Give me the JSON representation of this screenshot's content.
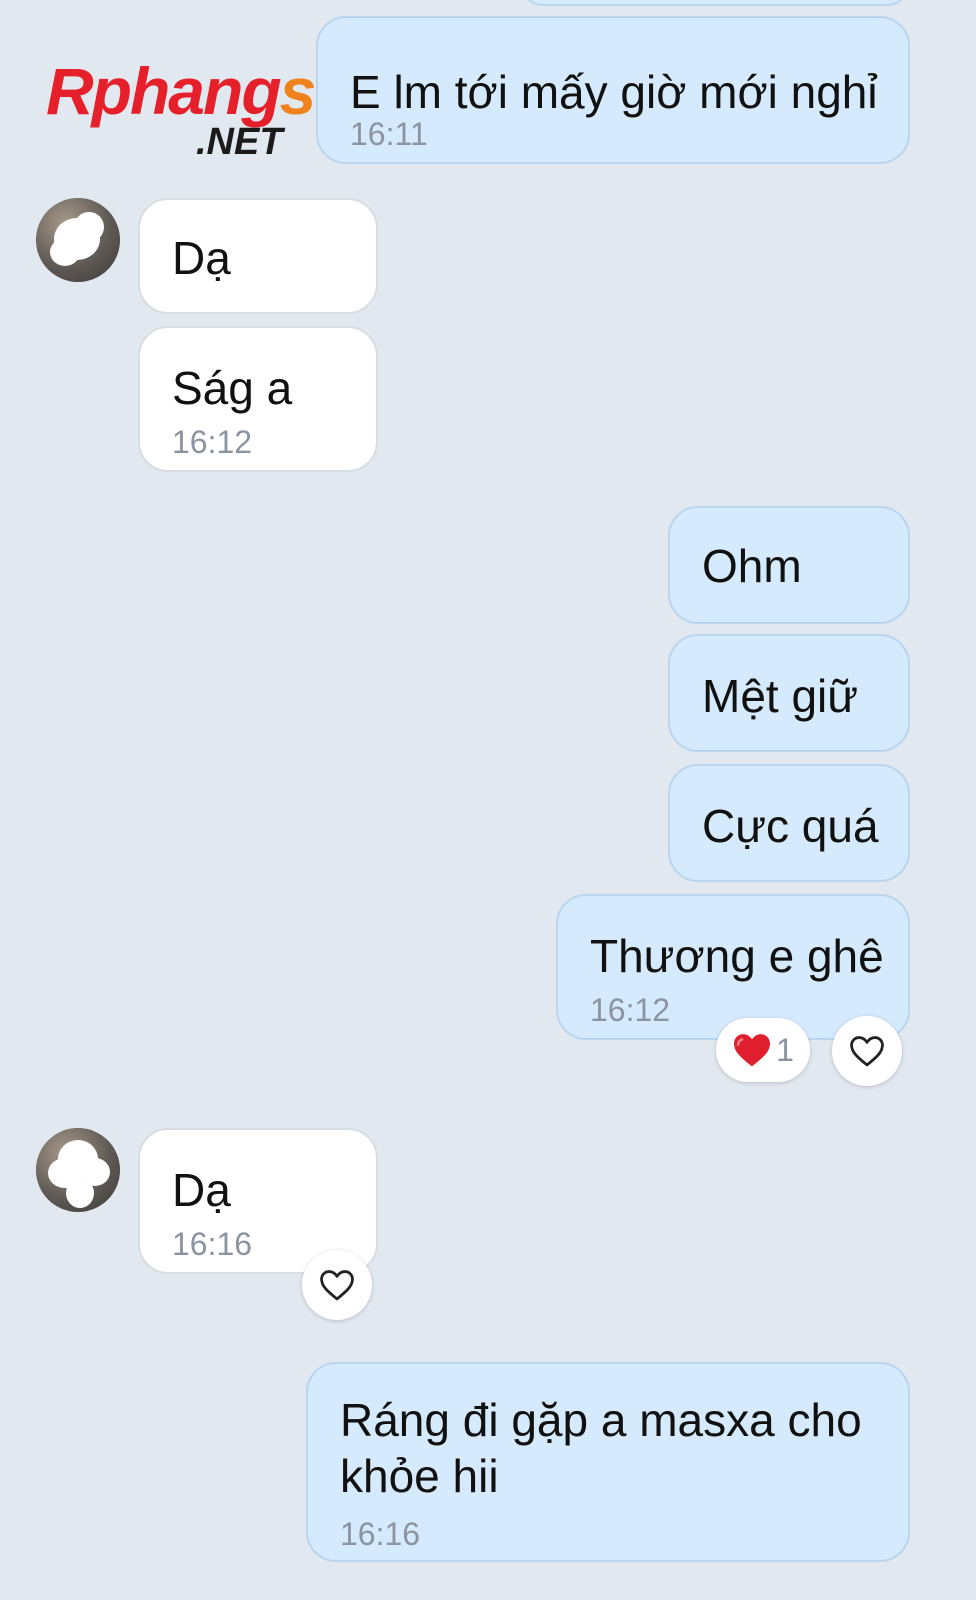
{
  "watermark": {
    "text_rphang": "Rphang",
    "text_s": "s",
    "text_net": ".NET"
  },
  "messages": [
    {
      "text": "E lm tới mấy giờ mới nghỉ",
      "time": "16:11"
    },
    {
      "text": "Dạ"
    },
    {
      "text": "Ság a",
      "time": "16:12"
    },
    {
      "text": "Ohm"
    },
    {
      "text": "Mệt giữ"
    },
    {
      "text": "Cực quá"
    },
    {
      "text": "Thương e ghê",
      "time": "16:12",
      "reaction_count": "1"
    },
    {
      "text": "Dạ",
      "time": "16:16"
    },
    {
      "text": "Ráng đi gặp a masxa cho khỏe hii",
      "time": "16:16"
    }
  ],
  "colors": {
    "outgoing_bubble": "#d5eafc",
    "incoming_bubble": "#ffffff",
    "background": "#e2e8f0",
    "heart_filled": "#e0202f",
    "time_text": "#8b94a0"
  },
  "icons": {
    "reaction_heart": "heart-filled-icon",
    "like_outline": "heart-outline-icon"
  }
}
